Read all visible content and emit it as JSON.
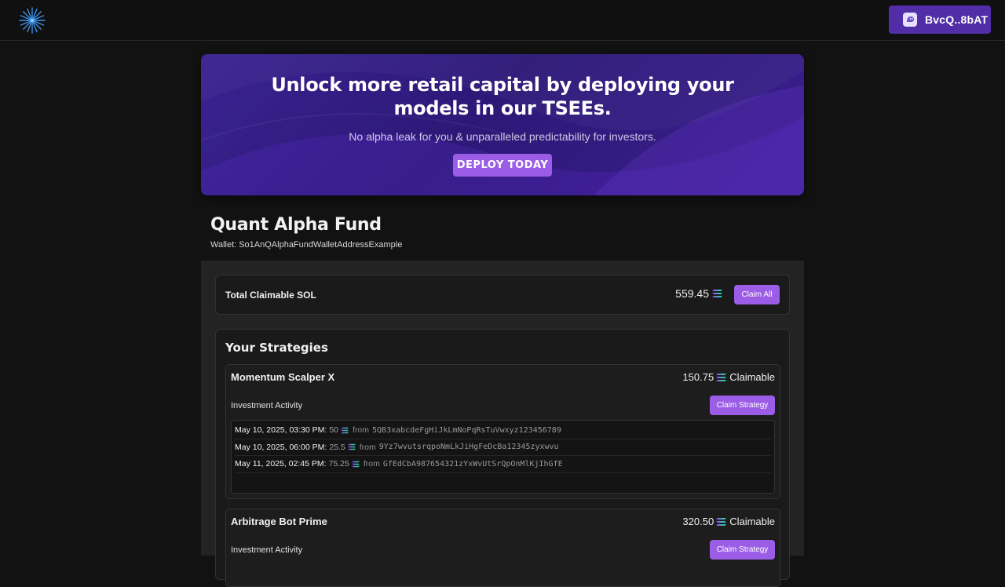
{
  "header": {
    "wallet_button_label": "BvcQ..8bAT",
    "logo_icon": "starburst-logo-icon",
    "wallet_icon": "wallet-ghost-icon"
  },
  "hero": {
    "title": "Unlock more retail capital by deploying your models in our TSEEs.",
    "subtitle": "No alpha leak for you & unparalleled predictability for investors.",
    "cta_label": "DEPLOY TODAY"
  },
  "fund": {
    "name": "Quant Alpha Fund",
    "wallet_label": "Wallet:",
    "wallet_address": "So1AnQAlphaFundWalletAddressExample"
  },
  "claimable": {
    "label": "Total Claimable SOL",
    "amount": "559.45",
    "claim_all_label": "Claim All"
  },
  "strategies": {
    "title": "Your Strategies",
    "items": [
      {
        "name": "Momentum Scalper X",
        "claimable_amount": "150.75",
        "claimable_label": "Claimable",
        "activity_label": "Investment Activity",
        "claim_label": "Claim Strategy",
        "activity": [
          {
            "date": "May 10, 2025, 03:30 PM:",
            "amount": "50",
            "from": "from",
            "address": "5QB3xabcdeFgHiJkLmNoPqRsTuVwxyz123456789"
          },
          {
            "date": "May 10, 2025, 06:00 PM:",
            "amount": "25.5",
            "from": "from",
            "address": "9Yz7wvutsrqpoNmLkJiHgFeDcBa12345zyxwvu"
          },
          {
            "date": "May 11, 2025, 02:45 PM:",
            "amount": "75.25",
            "from": "from",
            "address": "GfEdCbA987654321zYxWvUtSrQpOnMlKjIhGfE"
          }
        ]
      },
      {
        "name": "Arbitrage Bot Prime",
        "claimable_amount": "320.50",
        "claimable_label": "Claimable",
        "activity_label": "Investment Activity",
        "claim_label": "Claim Strategy"
      }
    ]
  },
  "colors": {
    "accent": "#9b5de5",
    "wallet_button": "#512da8",
    "hero_bg": "#2d1877",
    "page_bg": "#121212"
  },
  "icons": {
    "sol": "solana-icon"
  }
}
